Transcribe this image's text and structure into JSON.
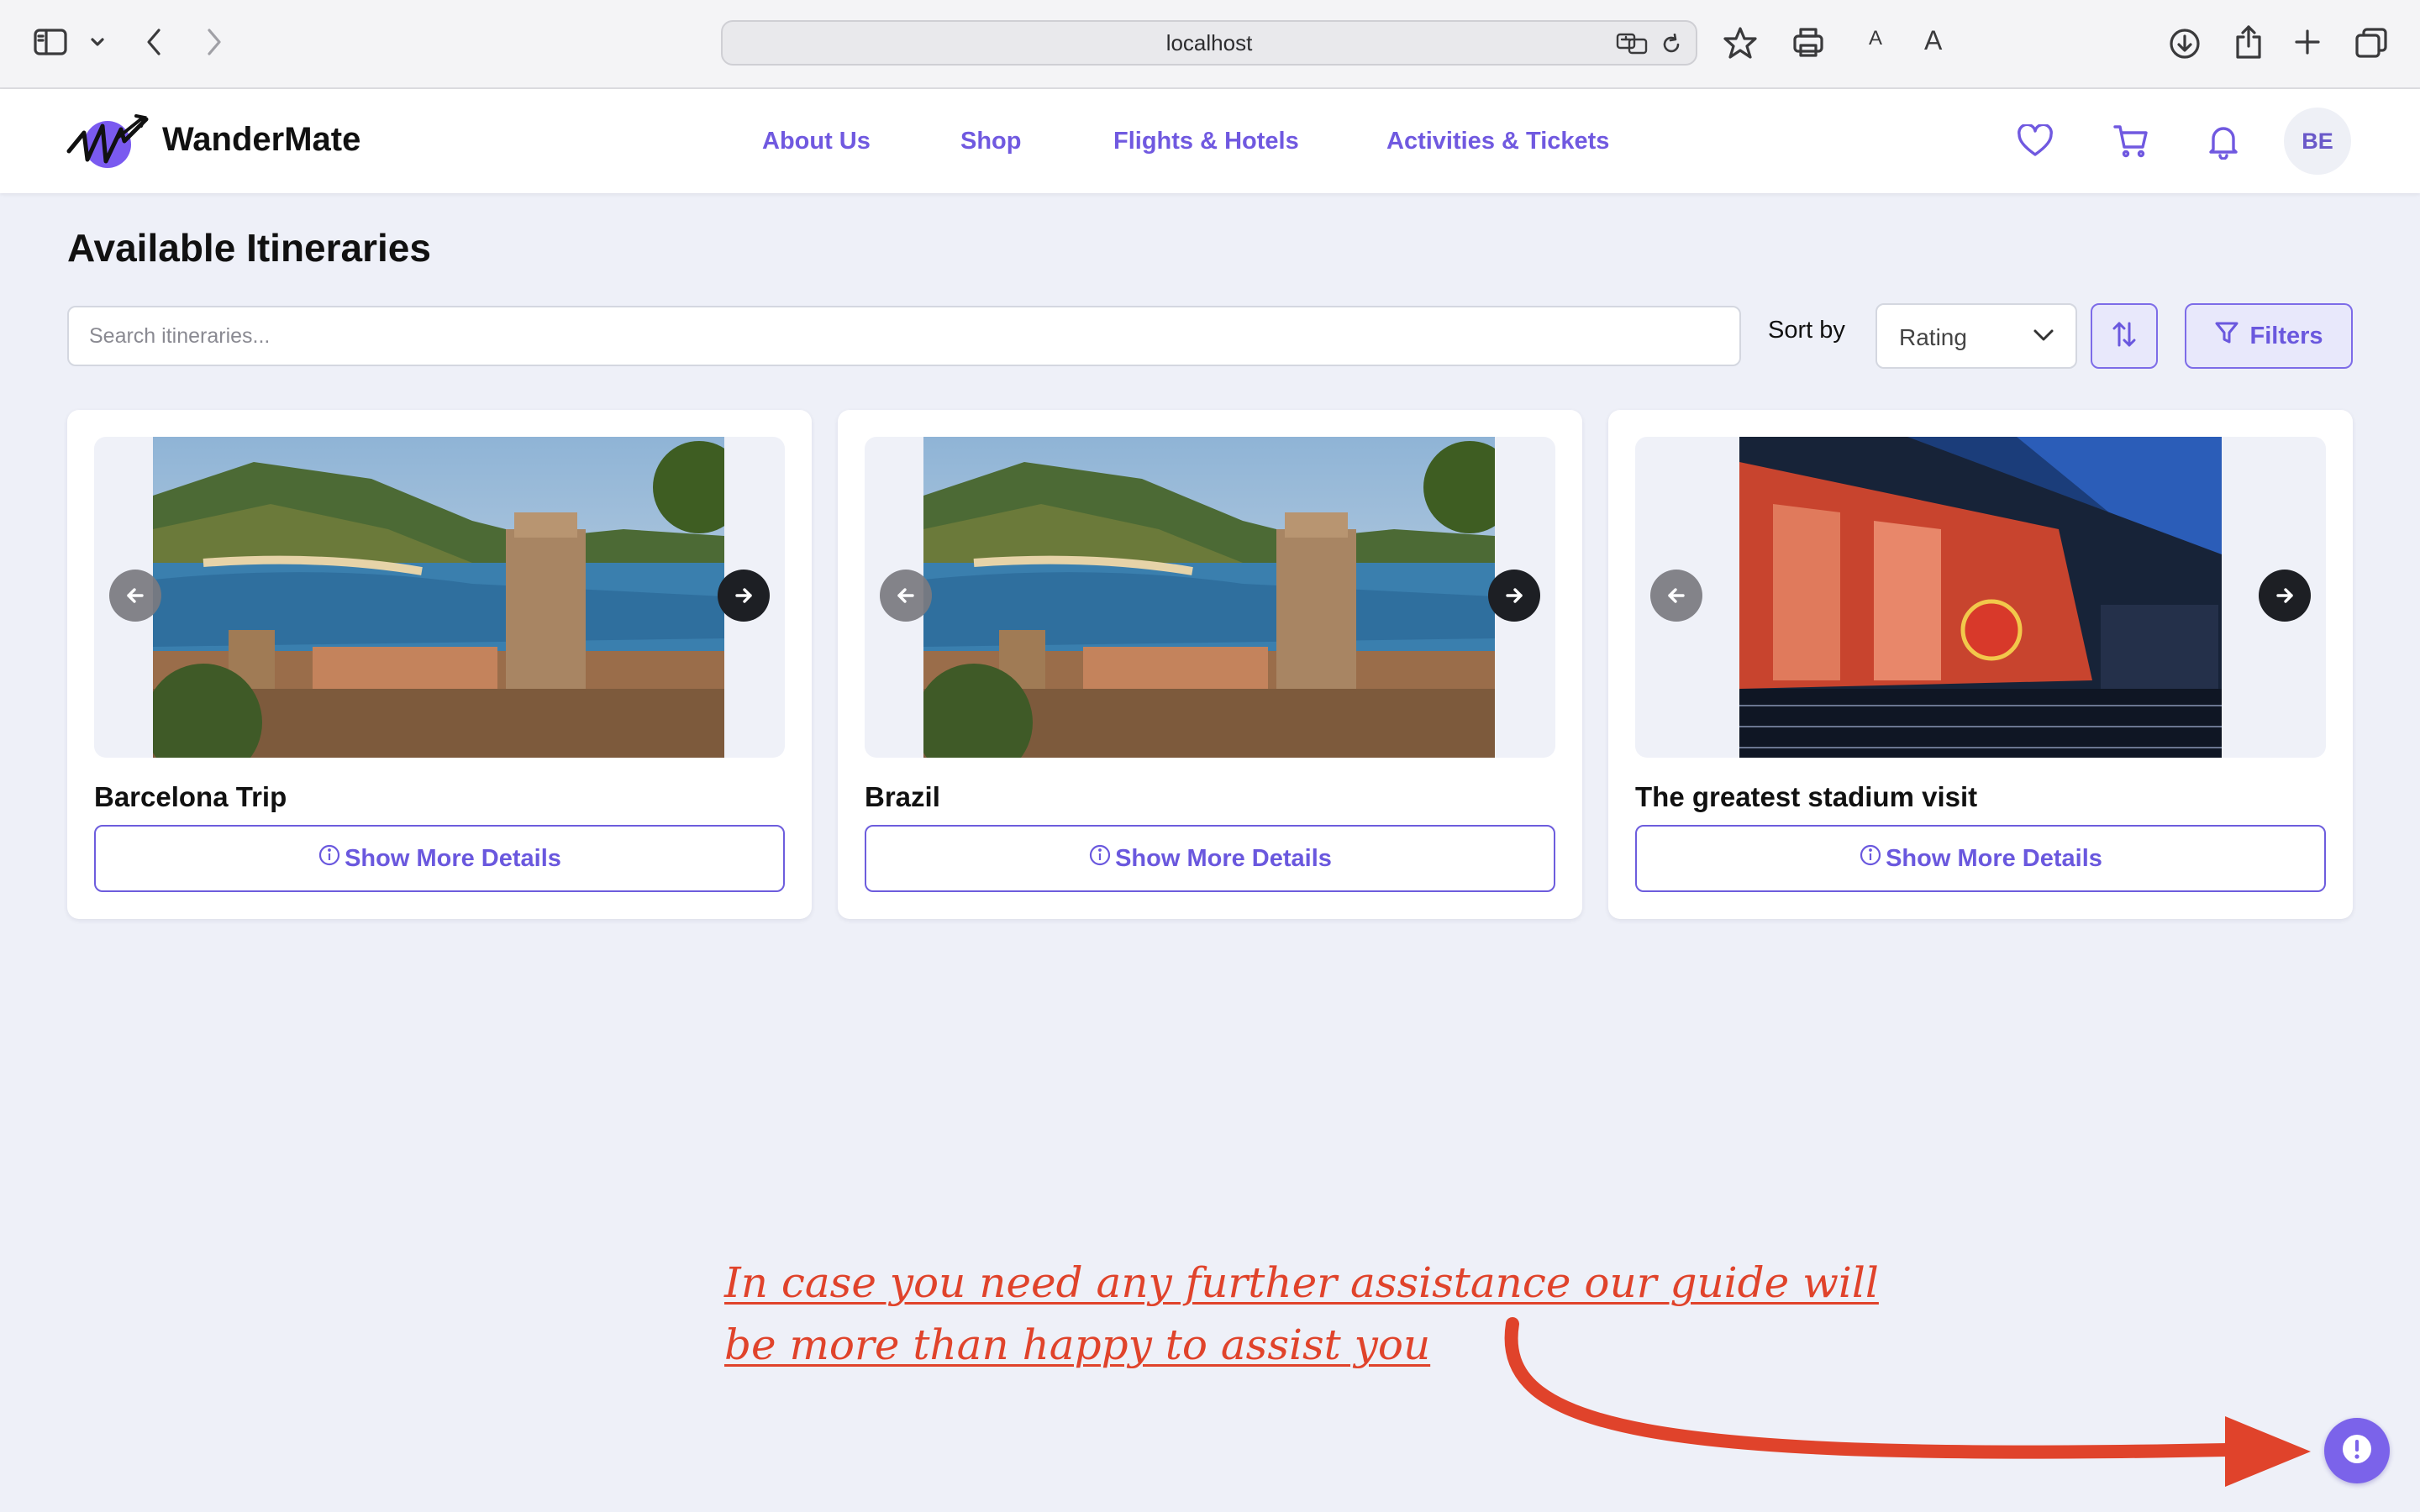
{
  "browser": {
    "url": "localhost",
    "font_small_label": "A",
    "font_large_label": "A"
  },
  "header": {
    "brand": "WanderMate",
    "nav": [
      {
        "label": "About Us"
      },
      {
        "label": "Shop"
      },
      {
        "label": "Flights & Hotels"
      },
      {
        "label": "Activities & Tickets"
      }
    ],
    "icons": [
      "heart-icon",
      "cart-icon",
      "bell-icon"
    ],
    "avatar_initials": "BE"
  },
  "main": {
    "title": "Available Itineraries",
    "search": {
      "placeholder": "Search itineraries...",
      "value": ""
    },
    "sort_label": "Sort by",
    "sort_value": "Rating",
    "filters_label": "Filters",
    "cards": [
      {
        "title": "Barcelona Trip",
        "button": "Show More Details",
        "image": "coastal-town-photo"
      },
      {
        "title": "Brazil",
        "button": "Show More Details",
        "image": "coastal-town-photo"
      },
      {
        "title": "The greatest stadium visit",
        "button": "Show More Details",
        "image": "stadium-photo"
      }
    ]
  },
  "annotation": {
    "line1": "In case you need any further assistance our guide will",
    "line2": "be more than happy to assist you"
  },
  "colors": {
    "accent": "#7059e0",
    "page_bg": "#eef0f8",
    "annotation": "#e0432b",
    "fab": "#7b63ea"
  }
}
